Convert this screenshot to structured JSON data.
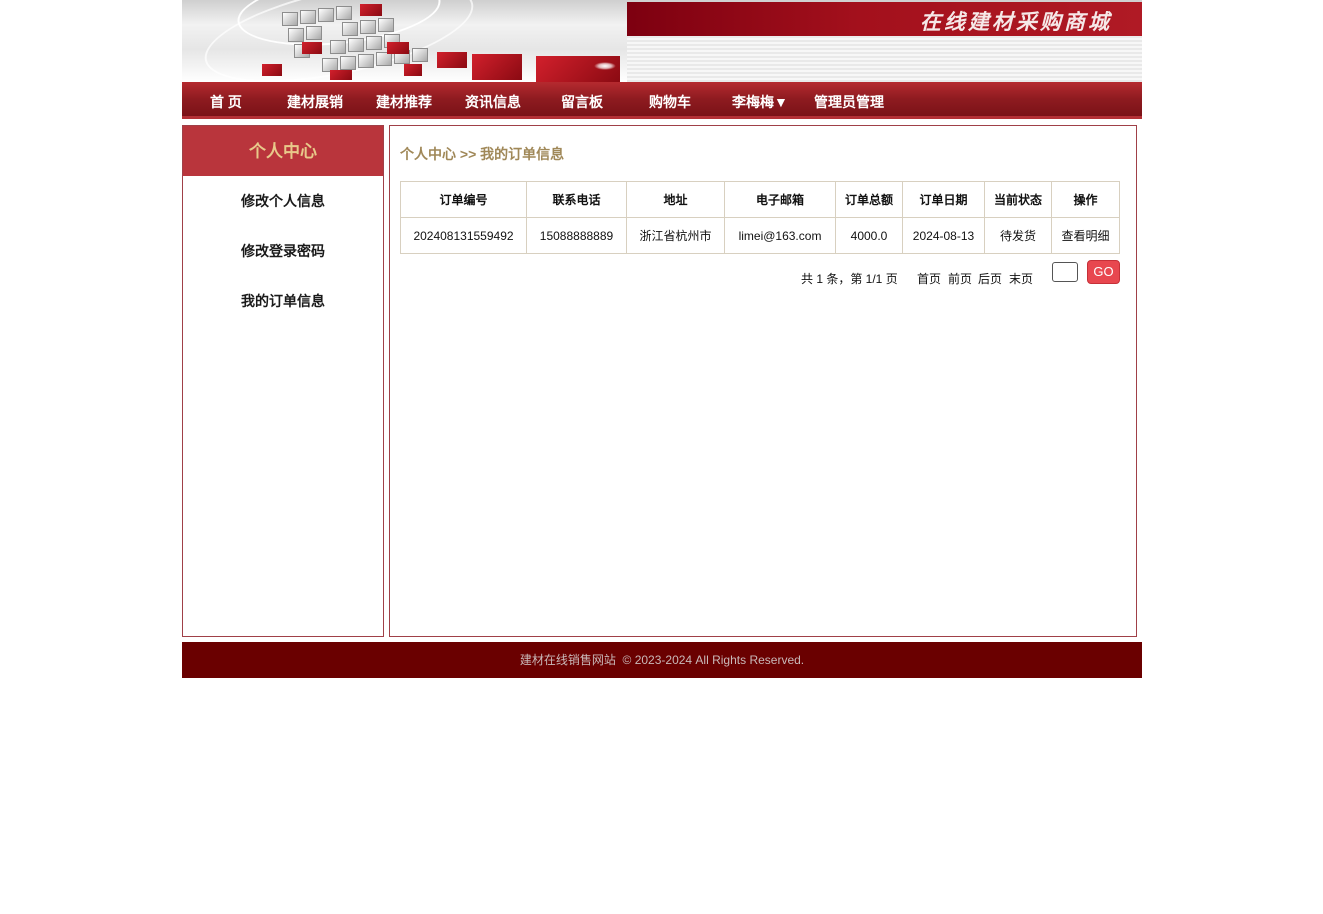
{
  "banner": {
    "site_title": "在线建材采购商城"
  },
  "nav": {
    "items": [
      {
        "label": "首 页"
      },
      {
        "label": "建材展销"
      },
      {
        "label": "建材推荐"
      },
      {
        "label": "资讯信息"
      },
      {
        "label": "留言板"
      },
      {
        "label": "购物车"
      },
      {
        "label": "李梅梅▼"
      },
      {
        "label": "管理员管理"
      }
    ]
  },
  "sidebar": {
    "header": "个人中心",
    "links": [
      {
        "label": "修改个人信息"
      },
      {
        "label": "修改登录密码"
      },
      {
        "label": "我的订单信息"
      }
    ]
  },
  "main": {
    "breadcrumb": {
      "root": "个人中心",
      "separator": " >> ",
      "current": "我的订单信息"
    },
    "table": {
      "headers": [
        "订单编号",
        "联系电话",
        "地址",
        "电子邮箱",
        "订单总额",
        "订单日期",
        "当前状态",
        "操作"
      ],
      "rows": [
        {
          "order_no": "202408131559492",
          "phone": "15088888889",
          "address": "浙江省杭州市",
          "email": "limei@163.com",
          "total": "4000.0",
          "date": "2024-08-13",
          "status": "待发货",
          "action": "查看明细"
        }
      ]
    },
    "pager": {
      "summary": "共 1 条，第 1/1 页",
      "first": "首页",
      "prev": "前页",
      "next": "后页",
      "last": "末页",
      "go_label": "GO",
      "page_input_value": ""
    }
  },
  "footer": {
    "text": "建材在线销售网站  © 2023-2024 All Rights Reserved."
  },
  "colors": {
    "brand_red": "#8e1b20",
    "sidebar_header": "#b9353c",
    "footer_bg": "#6a0000",
    "breadcrumb_text": "#a08858",
    "go_button": "#e8474f"
  }
}
